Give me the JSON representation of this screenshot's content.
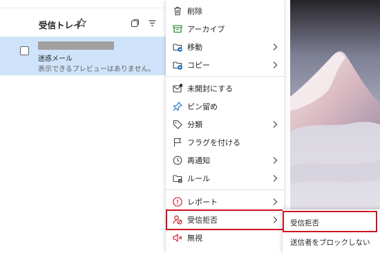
{
  "mail_list": {
    "folder_title": "受信トレイ",
    "items": [
      {
        "subject": "迷惑メール",
        "preview": "表示できるプレビューはありません。"
      }
    ]
  },
  "context_menu": {
    "items": [
      {
        "label": "削除",
        "icon": "trash-icon",
        "has_submenu": false
      },
      {
        "label": "アーカイブ",
        "icon": "archive-icon",
        "has_submenu": false
      },
      {
        "label": "移動",
        "icon": "move-folder-icon",
        "has_submenu": true
      },
      {
        "label": "コピー",
        "icon": "copy-folder-icon",
        "has_submenu": true
      },
      {
        "label": "未開封にする",
        "icon": "mark-unread-icon",
        "has_submenu": false
      },
      {
        "label": "ピン留め",
        "icon": "pin-icon",
        "has_submenu": false
      },
      {
        "label": "分類",
        "icon": "tag-icon",
        "has_submenu": true
      },
      {
        "label": "フラグを付ける",
        "icon": "flag-icon",
        "has_submenu": false
      },
      {
        "label": "再通知",
        "icon": "clock-icon",
        "has_submenu": true
      },
      {
        "label": "ルール",
        "icon": "rules-icon",
        "has_submenu": true
      },
      {
        "label": "レポート",
        "icon": "report-icon",
        "has_submenu": true
      },
      {
        "label": "受信拒否",
        "icon": "block-icon",
        "has_submenu": true
      },
      {
        "label": "無視",
        "icon": "ignore-icon",
        "has_submenu": false
      }
    ]
  },
  "submenu": {
    "items": [
      {
        "label": "受信拒否"
      },
      {
        "label": "送信者をブロックしない"
      }
    ]
  },
  "colors": {
    "selected_row": "#cfe4fa",
    "highlight_border": "#d01222",
    "archive_green": "#107c10",
    "accent_blue": "#0f6cbd",
    "report_red": "#c50f1f"
  }
}
